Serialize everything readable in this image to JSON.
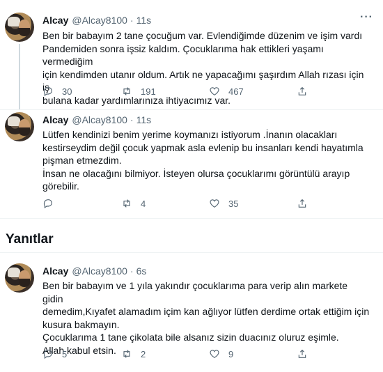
{
  "tweets": [
    {
      "name": "Alcay",
      "handle": "@Alcay8100",
      "time": "11s",
      "text": "Ben bir babayım 2 tane çocuğum var. Evlendiğimde düzenim ve işim vardı\nPandemiden sonra işsiz kaldım. Çocuklarıma hak ettikleri yaşamı vermediğim\niçin kendimden utanır oldum. Artık ne yapacağımı şaşırdım Allah rızası için iş\nbulana kadar yardımlarınıza ihtiyacımız var.",
      "replies": "30",
      "retweets": "191",
      "likes": "467"
    },
    {
      "name": "Alcay",
      "handle": "@Alcay8100",
      "time": "11s",
      "text": "Lütfen kendinizi benim yerime koymanızı istiyorum .İnanın olacakları\nkestirseydim değil çocuk yapmak asla evlenip bu insanları kendi hayatımla\npişman etmezdim.\nİnsan ne olacağını bilmiyor. İsteyen olursa çocuklarımı görüntülü arayıp\ngörebilir.",
      "replies": "",
      "retweets": "4",
      "likes": "35"
    },
    {
      "name": "Alcay",
      "handle": "@Alcay8100",
      "time": "6s",
      "text": "Ben bir babayım ve 1 yıla yakındır çocuklarıma para verip alın markete gidin\ndemedim,Kıyafet alamadım içim kan ağlıyor lütfen derdime ortak ettiğim için\nkusura bakmayın.\nÇocuklarıma 1 tane çikolata bile alsanız sizin duacınız oluruz eşimle.\nAllah kabul etsin.",
      "replies": "5",
      "retweets": "2",
      "likes": "9"
    }
  ],
  "sections": {
    "replies_title": "Yanıtlar"
  },
  "separators": {
    "dot": "·",
    "more": "···"
  },
  "icons": {
    "reply": "reply-icon",
    "retweet": "retweet-icon",
    "like": "heart-icon",
    "share": "share-icon",
    "more": "more-icon"
  },
  "colors": {
    "text": "#0f1419",
    "secondary": "#536471",
    "divider": "#eff3f4"
  }
}
